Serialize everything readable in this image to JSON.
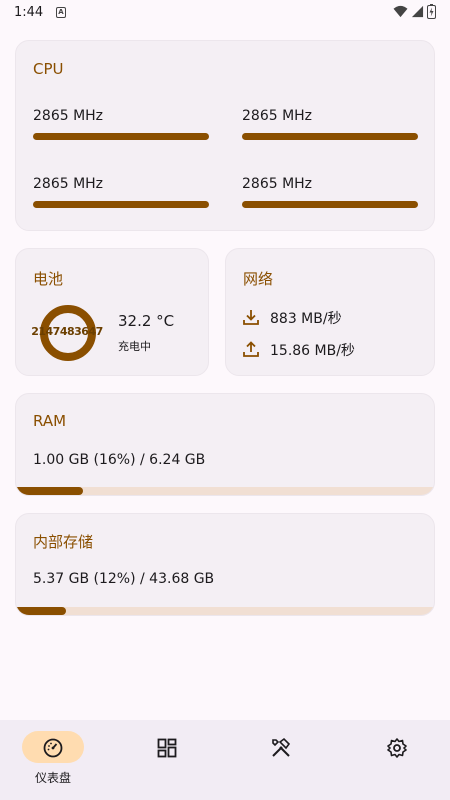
{
  "status_bar": {
    "time": "1:44",
    "notification_letter": "A"
  },
  "cpu": {
    "title": "CPU",
    "cores": [
      {
        "freq": "2865 MHz",
        "load": 1.0
      },
      {
        "freq": "2865 MHz",
        "load": 1.0
      },
      {
        "freq": "2865 MHz",
        "load": 1.0
      },
      {
        "freq": "2865 MHz",
        "load": 1.0
      }
    ]
  },
  "battery": {
    "title": "电池",
    "ring_value": "2147483647",
    "temperature": "32.2 °C",
    "state": "充电中"
  },
  "network": {
    "title": "网络",
    "download": "883 MB/秒",
    "upload": "15.86 MB/秒"
  },
  "ram": {
    "title": "RAM",
    "usage": "1.00 GB (16%) / 6.24 GB",
    "fraction": 0.16
  },
  "storage": {
    "title": "内部存储",
    "usage": "5.37 GB (12%) / 43.68 GB",
    "fraction": 0.12
  },
  "nav": {
    "dashboard_label": "仪表盘",
    "items": [
      "dashboard-icon",
      "apps-grid-icon",
      "tools-icon",
      "settings-icon"
    ]
  },
  "colors": {
    "accent": "#8a4f00",
    "track": "#f1dfd3",
    "card": "#f4eff4",
    "nav_pill": "#ffdcb0"
  }
}
